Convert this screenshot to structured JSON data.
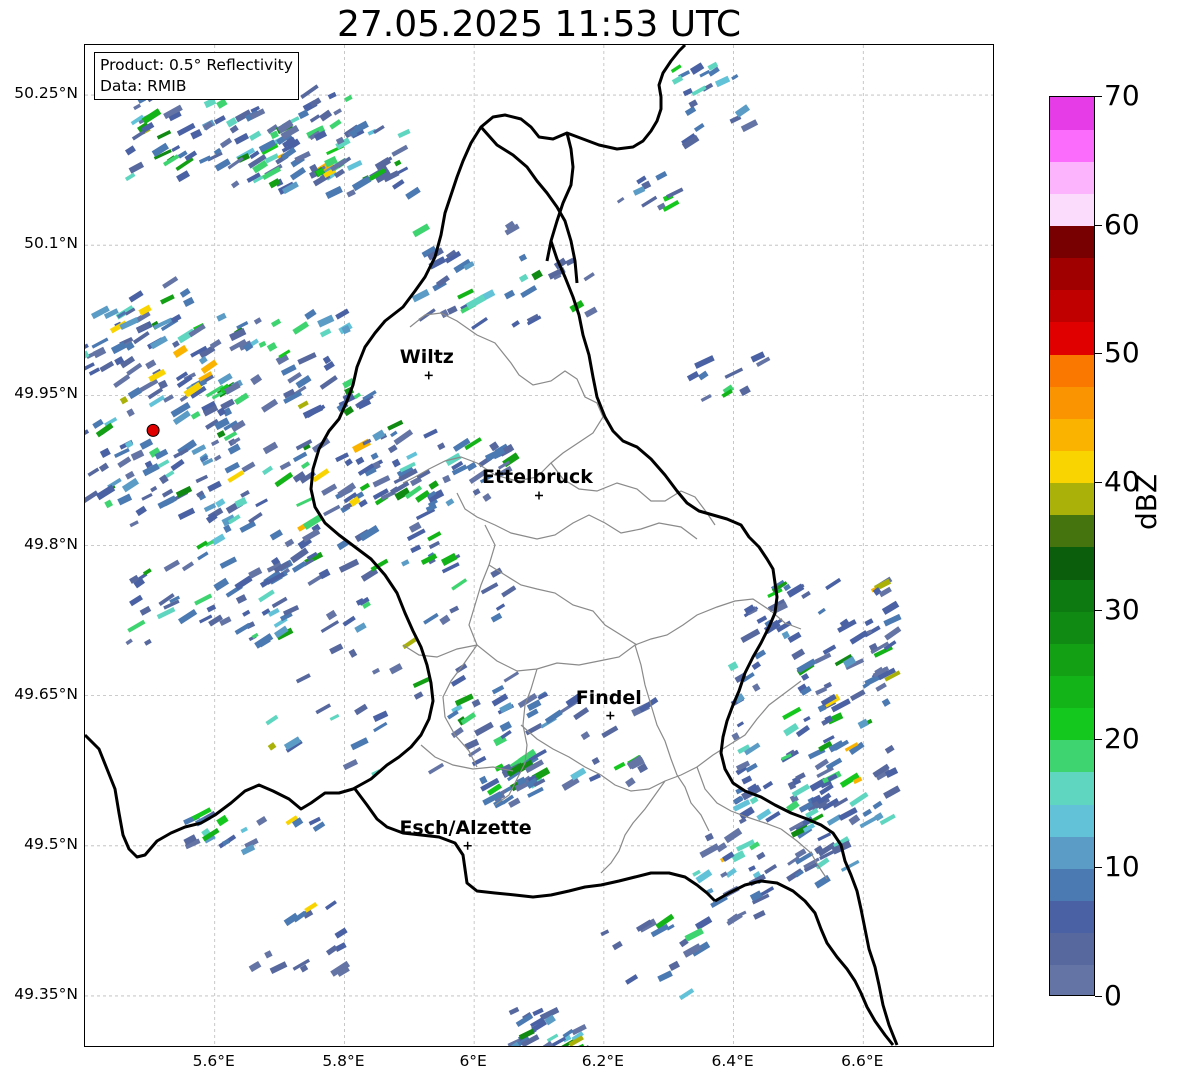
{
  "title": "27.05.2025 11:53 UTC",
  "info": {
    "product": "Product: 0.5° Reflectivity",
    "data": "Data: RMIB"
  },
  "lat_ticks": [
    {
      "label": "50.25°N",
      "value": 50.25
    },
    {
      "label": "50.1°N",
      "value": 50.1
    },
    {
      "label": "49.95°N",
      "value": 49.95
    },
    {
      "label": "49.8°N",
      "value": 49.8
    },
    {
      "label": "49.65°N",
      "value": 49.65
    },
    {
      "label": "49.5°N",
      "value": 49.5
    },
    {
      "label": "49.35°N",
      "value": 49.35
    }
  ],
  "lon_ticks": [
    {
      "label": "5.6°E",
      "value": 5.6
    },
    {
      "label": "5.8°E",
      "value": 5.8
    },
    {
      "label": "6°E",
      "value": 6.0
    },
    {
      "label": "6.2°E",
      "value": 6.2
    },
    {
      "label": "6.4°E",
      "value": 6.4
    },
    {
      "label": "6.6°E",
      "value": 6.6
    }
  ],
  "cities": [
    {
      "name": "Wiltz",
      "lon": 5.93,
      "lat": 49.97
    },
    {
      "name": "Ettelbruck",
      "lon": 6.1,
      "lat": 49.85
    },
    {
      "name": "Findel",
      "lon": 6.21,
      "lat": 49.63
    },
    {
      "name": "Esch/Alzette",
      "lon": 5.99,
      "lat": 49.5
    }
  ],
  "radar_site": {
    "lon": 5.505,
    "lat": 49.915
  },
  "colorbar": {
    "label": "dBZ",
    "min": 0,
    "max": 70,
    "ticks": [
      "0",
      "10",
      "20",
      "30",
      "40",
      "50",
      "60",
      "70"
    ],
    "colors": [
      "#6474a4",
      "#56689e",
      "#4a62a4",
      "#4b79b2",
      "#5a9cc6",
      "#62c2d8",
      "#5fd6c0",
      "#3ed470",
      "#14c81e",
      "#13b418",
      "#13a014",
      "#108a12",
      "#0c7a10",
      "#0a5e0c",
      "#45740e",
      "#aab20a",
      "#fad400",
      "#fab400",
      "#fa9400",
      "#fa7800",
      "#e00000",
      "#c00000",
      "#a00000",
      "#780000",
      "#fcdcfc",
      "#fcb4fc",
      "#fc6cfc",
      "#e63ce8"
    ]
  },
  "legend_map": {
    "extent": {
      "lon_min": 5.4,
      "lon_max": 6.8,
      "lat_min": 49.3,
      "lat_max": 50.3
    }
  }
}
